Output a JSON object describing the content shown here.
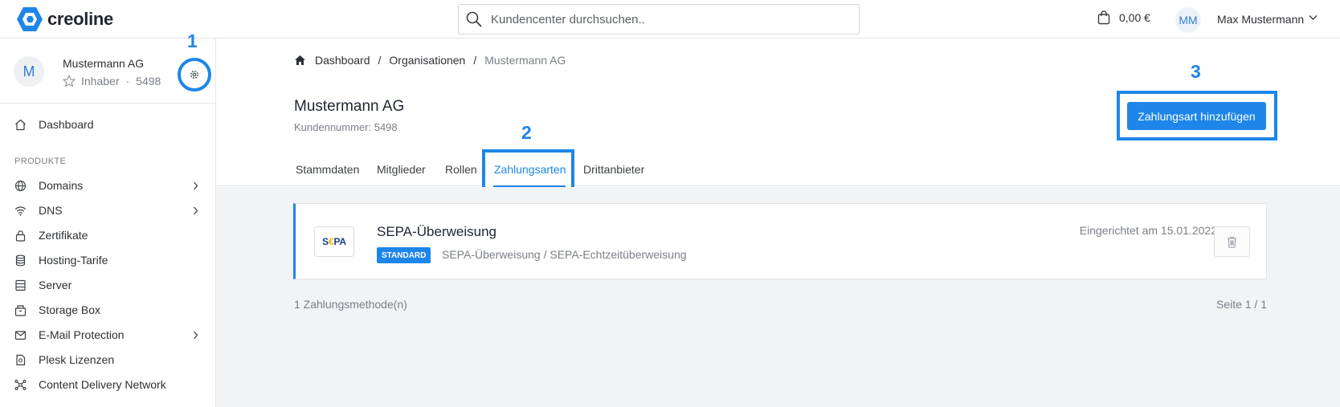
{
  "header": {
    "logo_text": "creoline",
    "search_placeholder": "Kundencenter durchsuchen..",
    "cart_amount": "0,00 €",
    "user_initials": "MM",
    "user_name": "Max Mustermann"
  },
  "sidebar": {
    "org": {
      "avatar": "M",
      "name": "Mustermann AG",
      "role": "Inhaber",
      "number": "5498"
    },
    "dashboard_label": "Dashboard",
    "section_label": "PRODUKTE",
    "items": [
      {
        "label": "Domains",
        "icon": "globe-icon",
        "has_chevron": true
      },
      {
        "label": "DNS",
        "icon": "wifi-icon",
        "has_chevron": true
      },
      {
        "label": "Zertifikate",
        "icon": "lock-icon",
        "has_chevron": false
      },
      {
        "label": "Hosting-Tarife",
        "icon": "database-icon",
        "has_chevron": false
      },
      {
        "label": "Server",
        "icon": "server-icon",
        "has_chevron": false
      },
      {
        "label": "Storage Box",
        "icon": "storage-icon",
        "has_chevron": false
      },
      {
        "label": "E-Mail Protection",
        "icon": "mail-icon",
        "has_chevron": true
      },
      {
        "label": "Plesk Lizenzen",
        "icon": "file-icon",
        "has_chevron": false
      },
      {
        "label": "Content Delivery Network",
        "icon": "network-icon",
        "has_chevron": false
      }
    ]
  },
  "annotations": {
    "one": "1",
    "two": "2",
    "three": "3"
  },
  "breadcrumb": {
    "home": "Dashboard",
    "sep1": "/",
    "orgs": "Organisationen",
    "sep2": "/",
    "current": "Mustermann AG"
  },
  "page": {
    "title": "Mustermann AG",
    "subtitle": "Kundennummer: 5498",
    "add_button": "Zahlungsart hinzufügen"
  },
  "tabs": [
    {
      "label": "Stammdaten",
      "active": false
    },
    {
      "label": "Mitglieder",
      "active": false
    },
    {
      "label": "Rollen",
      "active": false
    },
    {
      "label": "Zahlungsarten",
      "active": true
    },
    {
      "label": "Drittanbieter",
      "active": false
    }
  ],
  "payment_method": {
    "logo_text_a": "S",
    "logo_text_euro": "€",
    "logo_text_b": "PA",
    "title": "SEPA-Überweisung",
    "badge": "STANDARD",
    "description": "SEPA-Überweisung / SEPA-Echtzeitüberweisung",
    "date": "Eingerichtet am 15.01.2022"
  },
  "footer": {
    "count": "1 Zahlungsmethode(n)",
    "page": "Seite 1 / 1"
  },
  "colors": {
    "accent": "#1d86e8",
    "background": "#f2f3f5"
  }
}
